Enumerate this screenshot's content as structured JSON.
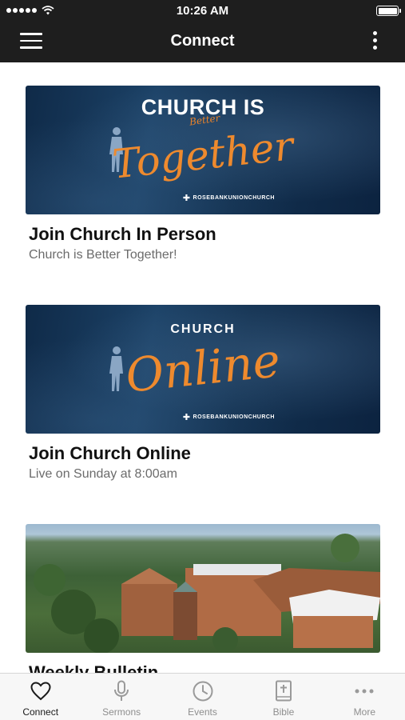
{
  "status_bar": {
    "time": "10:26 AM",
    "battery_level": 1.0
  },
  "nav_bar": {
    "title": "Connect"
  },
  "cards": [
    {
      "banner_heading": "CHURCH IS",
      "banner_subscript": "Better",
      "banner_script": "Together",
      "banner_logo": "ROSEBANKUNIONCHURCH",
      "title": "Join Church In Person",
      "subtitle": "Church is Better Together!"
    },
    {
      "banner_heading": "CHURCH",
      "banner_script": "Online",
      "banner_logo": "ROSEBANKUNIONCHURCH",
      "title": "Join Church Online",
      "subtitle": "Live on Sunday at 8:00am"
    },
    {
      "title": "Weekly Bulletin"
    }
  ],
  "tab_bar": {
    "items": [
      {
        "label": "Connect",
        "icon": "heart-icon",
        "active": true
      },
      {
        "label": "Sermons",
        "icon": "microphone-icon",
        "active": false
      },
      {
        "label": "Events",
        "icon": "clock-icon",
        "active": false
      },
      {
        "label": "Bible",
        "icon": "bible-icon",
        "active": false
      },
      {
        "label": "More",
        "icon": "more-dots-icon",
        "active": false
      }
    ]
  },
  "colors": {
    "bar_background": "#1e1e1e",
    "banner_blue": "#143556",
    "banner_orange": "#ee8a2e",
    "tab_active": "#1a1a1a",
    "tab_inactive": "#8e8e8e"
  }
}
